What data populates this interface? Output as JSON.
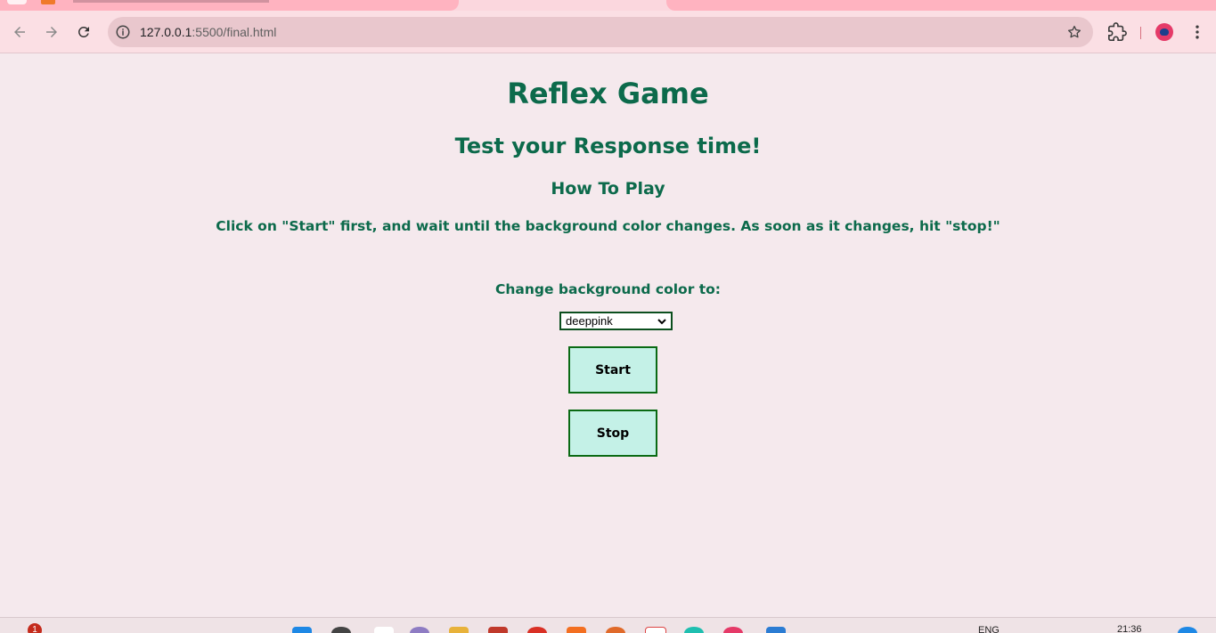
{
  "browser": {
    "url_host": "127.0.0.1",
    "url_path": ":5500/final.html"
  },
  "page": {
    "title": "Reflex Game",
    "subtitle": "Test your Response time!",
    "howto_heading": "How To Play",
    "instructions": "Click on \"Start\" first, and wait until the background color changes. As soon as it changes, hit \"stop!\"",
    "color_label": "Change background color to:",
    "color_select_value": "deeppink",
    "start_label": "Start",
    "stop_label": "Stop"
  },
  "taskbar": {
    "notification_count": "1",
    "language": "ENG",
    "time": "21:36"
  },
  "colors": {
    "page_background": "#f5e9ed",
    "heading_text": "#0c6a4b",
    "button_fill": "#c4f1e7",
    "button_border": "#0a6a14",
    "toolbar": "#fbdfe4"
  }
}
